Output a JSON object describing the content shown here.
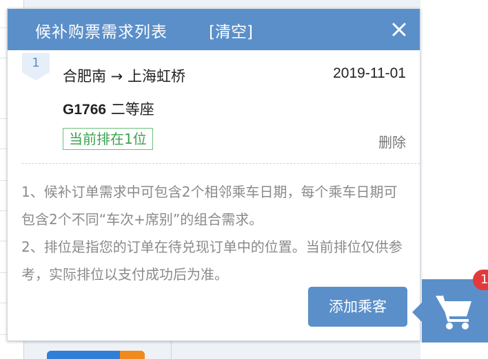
{
  "header": {
    "title": "候补购票需求列表",
    "clear_label": "[清空]",
    "close_icon": "close-icon"
  },
  "ticket": {
    "index": "1",
    "route": "合肥南 → 上海虹桥",
    "date": "2019-11-01",
    "train_no": "G1766",
    "seat": "二等座",
    "queue_status": "当前排在1位",
    "delete_label": "删除"
  },
  "notes": [
    "1、候补订单需求中可包含2个相邻乘车日期，每个乘车日期可包含2个不同“车次+席别”的组合需求。",
    "2、排位是指您的订单在待兑现订单中的位置。当前排位仅供参考，实际排位以支付成功后为准。"
  ],
  "add_passenger_label": "添加乘客",
  "cart": {
    "icon": "cart-icon",
    "count": "1"
  },
  "colors": {
    "accent": "#5b8fc9",
    "queue_green": "#3aa14f",
    "badge_red": "#e4393c"
  }
}
